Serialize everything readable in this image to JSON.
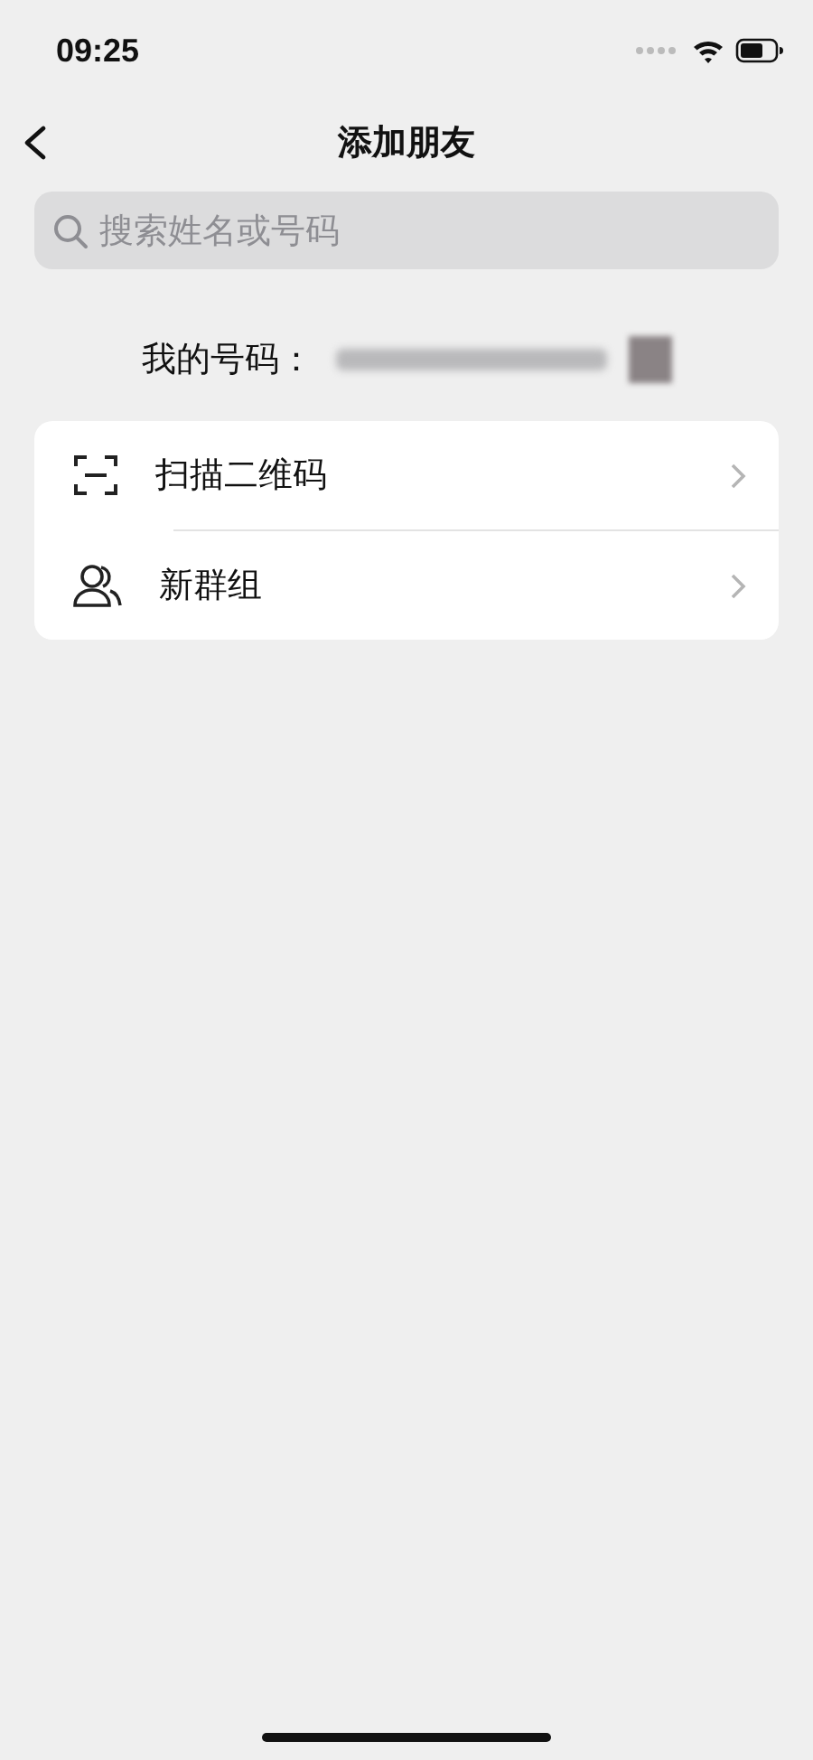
{
  "status_bar": {
    "time": "09:25"
  },
  "nav_bar": {
    "title": "添加朋友"
  },
  "search": {
    "placeholder": "搜索姓名或号码"
  },
  "my_number": {
    "label": "我的号码："
  },
  "menu": [
    {
      "kind": "scan",
      "label": "扫描二维码"
    },
    {
      "kind": "group",
      "label": "新群组"
    }
  ]
}
